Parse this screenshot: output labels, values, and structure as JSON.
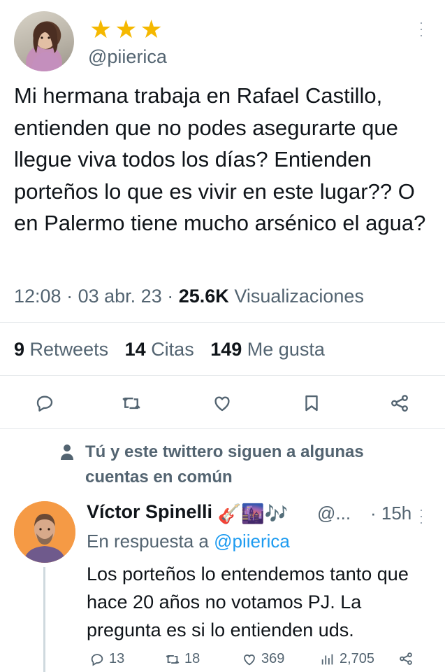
{
  "tweet": {
    "stars": "★★★",
    "handle": "@piierica",
    "text": "Mi hermana trabaja en Rafael Castillo, entienden que no podes asegurarte que llegue viva todos los días? Entienden porteños lo que es vivir en este lugar?? O en Palermo tiene mucho arsénico el agua?",
    "time": "12:08",
    "date": "03 abr. 23",
    "views_count": "25.6K",
    "views_label": "Visualizaciones",
    "retweets_count": "9",
    "retweets_label": "Retweets",
    "quotes_count": "14",
    "quotes_label": "Citas",
    "likes_count": "149",
    "likes_label": "Me gusta"
  },
  "follow_note": "Tú y este twittero siguen a algunas cuentas en común",
  "reply": {
    "name": "Víctor Spinelli",
    "emojis": "🎸🌆🎶",
    "handle": "@...",
    "time": "· 15h",
    "replying_label": "En respuesta a",
    "replying_handle": "@piierica",
    "text": "Los porteños lo entendemos tanto que hace 20 años no votamos PJ. La pregunta es si lo entienden uds.",
    "replies": "13",
    "retweets": "18",
    "likes": "369",
    "views": "2,705"
  },
  "colors": {
    "star": "#f5b800",
    "link": "#1d9bf0",
    "secondary_text": "#536471",
    "avatar_bg": "#f59a45"
  },
  "icons": [
    "reply-icon",
    "retweet-icon",
    "like-icon",
    "bookmark-icon",
    "share-icon",
    "person-icon",
    "more-icon",
    "views-icon"
  ]
}
